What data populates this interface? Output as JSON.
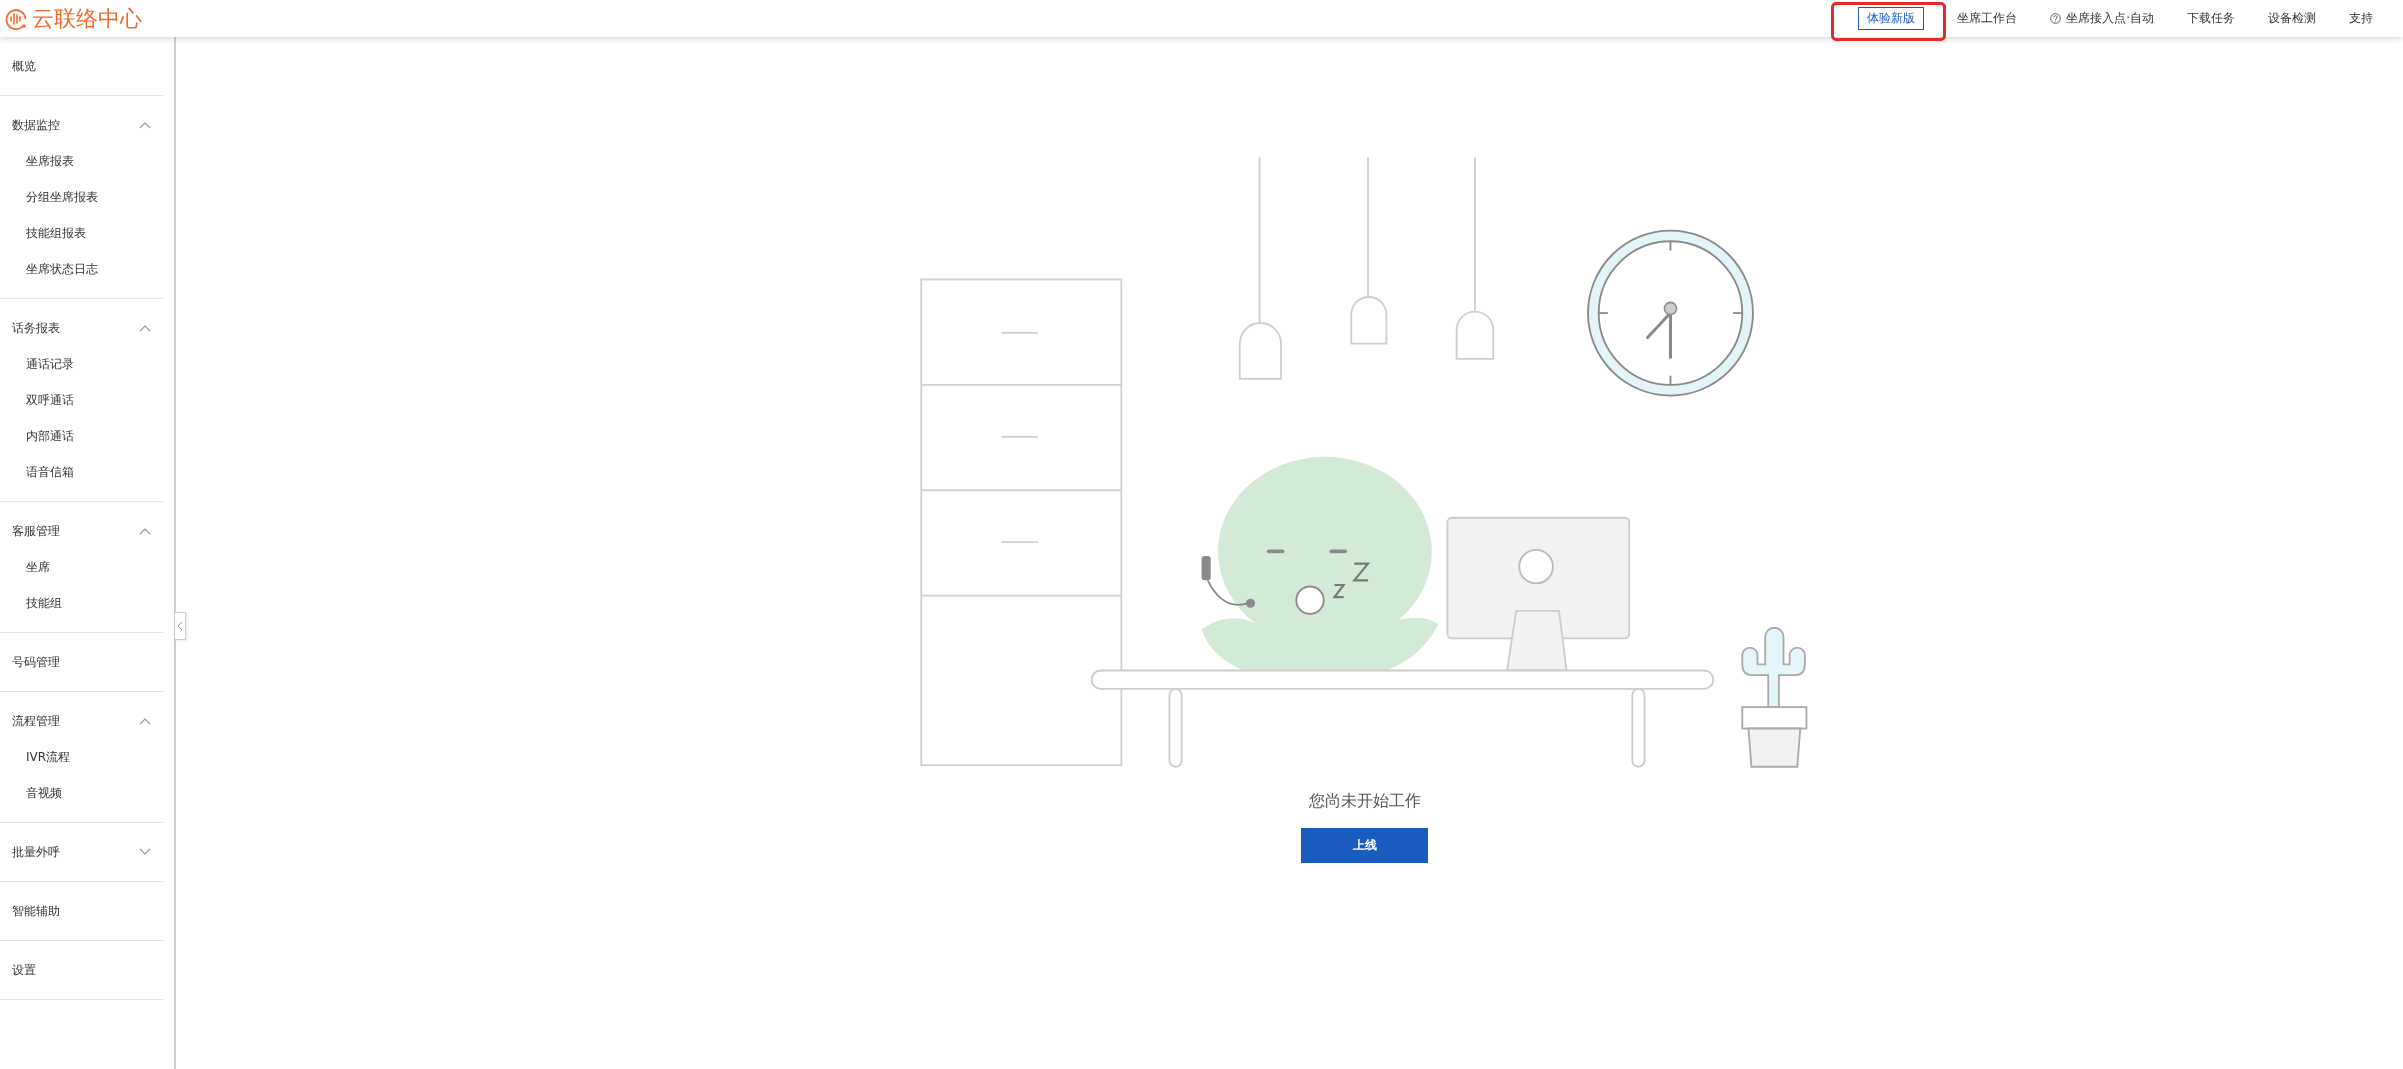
{
  "header": {
    "logo_text": "云联络中心",
    "nav": [
      {
        "label": "体验新版",
        "kind": "outlined",
        "highlighted": true
      },
      {
        "label": "坐席工作台",
        "kind": "plain",
        "highlighted": false
      },
      {
        "label": "坐席接入点·自动",
        "kind": "help",
        "highlighted": false
      },
      {
        "label": "下载任务",
        "kind": "plain",
        "highlighted": false
      },
      {
        "label": "设备检测",
        "kind": "plain",
        "highlighted": false
      },
      {
        "label": "支持",
        "kind": "plain",
        "highlighted": false
      }
    ]
  },
  "sidebar": {
    "sections": [
      {
        "label": "概览"
      },
      {
        "label": "数据监控",
        "expanded": true,
        "children": [
          {
            "label": "坐席报表"
          },
          {
            "label": "分组坐席报表"
          },
          {
            "label": "技能组报表"
          },
          {
            "label": "坐席状态日志"
          }
        ]
      },
      {
        "label": "话务报表",
        "expanded": true,
        "children": [
          {
            "label": "通话记录"
          },
          {
            "label": "双呼通话"
          },
          {
            "label": "内部通话"
          },
          {
            "label": "语音信箱"
          }
        ]
      },
      {
        "label": "客服管理",
        "expanded": true,
        "children": [
          {
            "label": "坐席"
          },
          {
            "label": "技能组"
          }
        ]
      },
      {
        "label": "号码管理"
      },
      {
        "label": "流程管理",
        "expanded": true,
        "children": [
          {
            "label": "IVR流程"
          },
          {
            "label": "音视频"
          }
        ]
      },
      {
        "label": "批量外呼",
        "expanded": false
      },
      {
        "label": "智能辅助"
      },
      {
        "label": "设置"
      }
    ]
  },
  "empty_state": {
    "message": "您尚未开始工作",
    "button": "上线"
  }
}
